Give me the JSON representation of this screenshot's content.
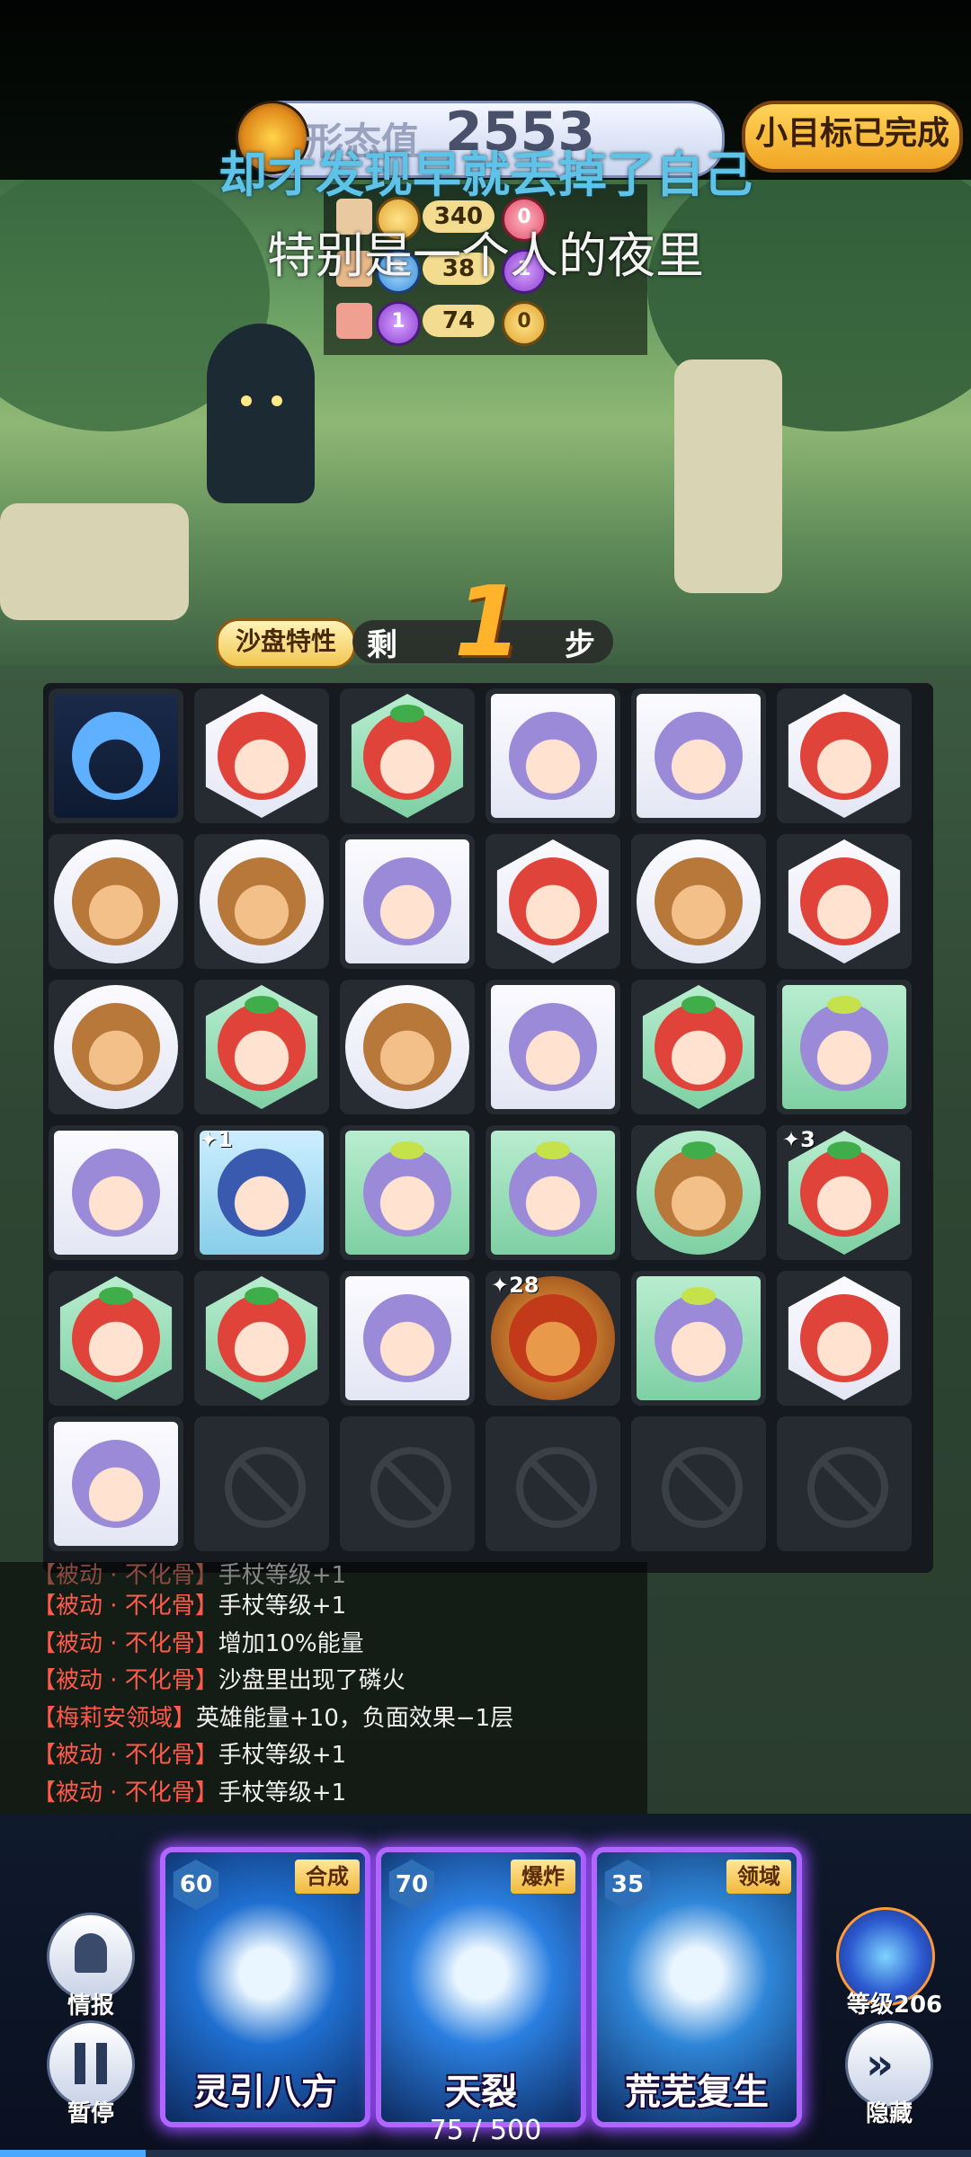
{
  "header": {
    "score_label": "形态值",
    "score_value": "2553",
    "goal_button": "小目标已完成"
  },
  "lyrics": {
    "line1": "却才发现早就丢掉了自己",
    "line2": "特别是一个人的夜里"
  },
  "stats": {
    "row1": {
      "gold": "",
      "num": "340",
      "pink": "0"
    },
    "row2": {
      "blue": "3",
      "num": "38",
      "purple": "1"
    },
    "row3": {
      "purple": "1",
      "num": "74",
      "gold": "0"
    }
  },
  "steps": {
    "feature_label": "沙盘特性",
    "left": "剩",
    "count": "1",
    "right": "步"
  },
  "board": {
    "rows": [
      [
        {
          "t": "flame",
          "shape": "sq",
          "bg": "dark"
        },
        {
          "t": "red",
          "shape": "hex",
          "bg": "white"
        },
        {
          "t": "redgreen",
          "shape": "hex",
          "bg": "green"
        },
        {
          "t": "purple",
          "shape": "sq",
          "bg": "white"
        },
        {
          "t": "purple",
          "shape": "sq",
          "bg": "white"
        },
        {
          "t": "red",
          "shape": "hex",
          "bg": "white"
        }
      ],
      [
        {
          "t": "monkey",
          "shape": "circ",
          "bg": "white"
        },
        {
          "t": "monkey",
          "shape": "circ",
          "bg": "white"
        },
        {
          "t": "purple",
          "shape": "sq",
          "bg": "white"
        },
        {
          "t": "red",
          "shape": "hex",
          "bg": "white"
        },
        {
          "t": "monkey",
          "shape": "circ",
          "bg": "white"
        },
        {
          "t": "red",
          "shape": "hex",
          "bg": "white"
        }
      ],
      [
        {
          "t": "monkey",
          "shape": "circ",
          "bg": "white"
        },
        {
          "t": "redgreen",
          "shape": "hex",
          "bg": "green"
        },
        {
          "t": "monkey",
          "shape": "circ",
          "bg": "white"
        },
        {
          "t": "purple",
          "shape": "sq",
          "bg": "white"
        },
        {
          "t": "redgreen",
          "shape": "hex",
          "bg": "green"
        },
        {
          "t": "purpleflower",
          "shape": "sq",
          "bg": "green",
          "glow": true
        }
      ],
      [
        {
          "t": "purple",
          "shape": "sq",
          "bg": "white"
        },
        {
          "t": "hatgirl",
          "shape": "sq",
          "bg": "lightblue",
          "badge": "1"
        },
        {
          "t": "purpleflower",
          "shape": "sq",
          "bg": "green"
        },
        {
          "t": "purpleflower",
          "shape": "sq",
          "bg": "green"
        },
        {
          "t": "monkeygreen",
          "shape": "circ",
          "bg": "green",
          "glow": true
        },
        {
          "t": "redgreen",
          "shape": "hex",
          "bg": "green",
          "glow": true,
          "badge": "3"
        }
      ],
      [
        {
          "t": "redgreen",
          "shape": "hex",
          "bg": "green",
          "glow": true
        },
        {
          "t": "redgreen",
          "shape": "hex",
          "bg": "green"
        },
        {
          "t": "purple",
          "shape": "sq",
          "bg": "white"
        },
        {
          "t": "boss",
          "shape": "circ",
          "bg": "dark",
          "badge": "28"
        },
        {
          "t": "purpleflower",
          "shape": "sq",
          "bg": "green"
        },
        {
          "t": "red",
          "shape": "hex",
          "bg": "white"
        }
      ],
      [
        {
          "t": "purple",
          "shape": "sq",
          "bg": "white"
        },
        {
          "t": "blocked"
        },
        {
          "t": "blocked"
        },
        {
          "t": "blocked"
        },
        {
          "t": "blocked"
        },
        {
          "t": "blocked"
        }
      ]
    ]
  },
  "log": [
    {
      "tag": "【被动 · 不化骨】",
      "text": "手杖等级+1"
    },
    {
      "tag": "【被动 · 不化骨】",
      "text": "手杖等级+1"
    },
    {
      "tag": "【被动 · 不化骨】",
      "text": "增加10%能量"
    },
    {
      "tag": "【被动 · 不化骨】",
      "text": "沙盘里出现了磷火"
    },
    {
      "tag": "【梅莉安领域】",
      "text": "英雄能量+10，负面效果−1层"
    },
    {
      "tag": "【被动 · 不化骨】",
      "text": "手杖等级+1"
    },
    {
      "tag": "【被动 · 不化骨】",
      "text": "手杖等级+1"
    }
  ],
  "controls": {
    "intel_label": "情报",
    "pause_label": "暂停",
    "hide_label": "隐藏",
    "level_label": "等级206"
  },
  "cards": [
    {
      "cost": "60",
      "tag": "合成",
      "name": "灵引八方",
      "color": "#1f6fd0"
    },
    {
      "cost": "70",
      "tag": "爆炸",
      "name": "天裂",
      "color": "#2b7fe0"
    },
    {
      "cost": "35",
      "tag": "领域",
      "name": "荒芜复生",
      "color": "#2f86d8"
    }
  ],
  "pager": "75 / 500",
  "progress_fraction": 0.15,
  "colors": {
    "accent": "#3fe3ff",
    "card_border": "#b067ff",
    "log_tag": "#ff5a4a",
    "steps_number": "#ffb32a"
  }
}
